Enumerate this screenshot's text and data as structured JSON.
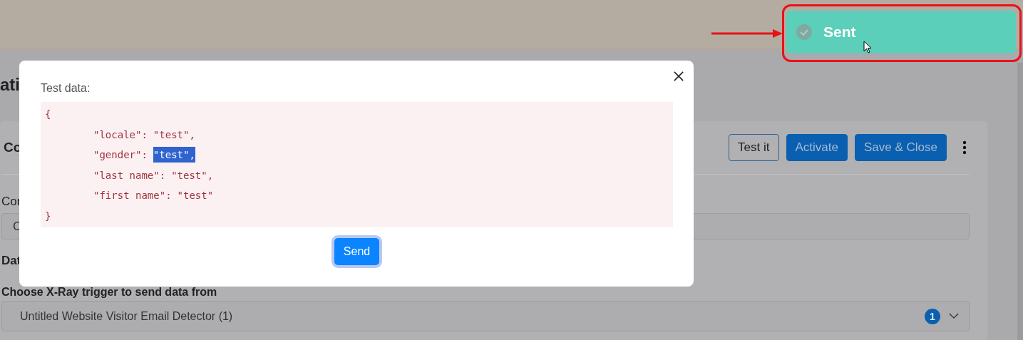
{
  "page": {
    "title": "ati",
    "card": {
      "title": "Co",
      "buttons": [
        {
          "label": "Test it",
          "kind": "outline"
        },
        {
          "label": "Activate",
          "kind": "primary"
        },
        {
          "label": "Save & Close",
          "kind": "primary"
        }
      ],
      "field_label": "Cor",
      "field_value": "C",
      "section_title": "Dat",
      "trigger_label": "Choose X-Ray trigger to send data from",
      "trigger_select": {
        "value": "Untitled Website Visitor Email Detector (1)",
        "count": "1"
      }
    }
  },
  "modal": {
    "label": "Test data:",
    "code": [
      {
        "kind": "brace",
        "text": "{"
      },
      {
        "kind": "entry",
        "key": "\"locale\":",
        "value": "\"test\",",
        "selected": false
      },
      {
        "kind": "entry",
        "key": "\"gender\":",
        "value": "\"test\",",
        "selected": true
      },
      {
        "kind": "entry",
        "key": "\"last name\":",
        "value": "\"test\",",
        "selected": false
      },
      {
        "kind": "entry",
        "key": "\"first name\":",
        "value": "\"test\"",
        "selected": false
      },
      {
        "kind": "brace",
        "text": "}"
      }
    ],
    "send_button": "Send"
  },
  "toast": {
    "message": "Sent",
    "kind": "success"
  }
}
